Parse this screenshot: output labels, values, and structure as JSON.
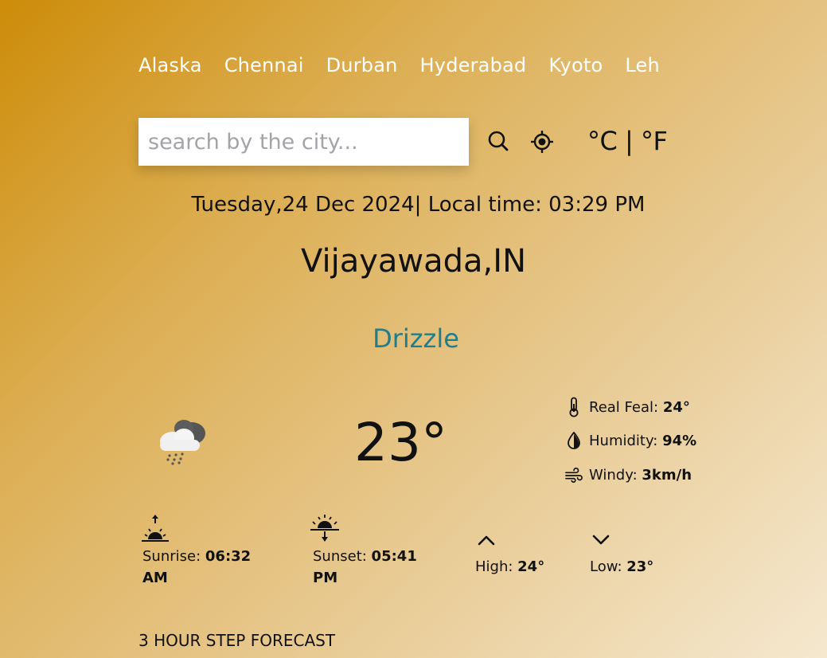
{
  "cities": [
    "Alaska",
    "Chennai",
    "Durban",
    "Hyderabad",
    "Kyoto",
    "Leh"
  ],
  "search": {
    "placeholder": "search by the city...",
    "value": ""
  },
  "icons": {
    "search": "search-icon",
    "location": "location-target-icon"
  },
  "units": {
    "label": "°C | °F"
  },
  "datetime": "Tuesday,24 Dec 2024| Local time: 03:29 PM",
  "location": "Vijayawada,IN",
  "condition": "Drizzle",
  "temperature": "23°",
  "details": {
    "realfeel": {
      "label": "Real Feal: ",
      "value": "24°"
    },
    "humidity": {
      "label": "Humidity: ",
      "value": "94%"
    },
    "wind": {
      "label": "Windy: ",
      "value": "3km/h"
    }
  },
  "sun": {
    "sunrise": {
      "label": "Sunrise: ",
      "value": "06:32",
      "suffix": "AM"
    },
    "sunset": {
      "label": "Sunset: ",
      "value": "05:41",
      "suffix": "PM"
    }
  },
  "range": {
    "high": {
      "label": "High: ",
      "value": "24°"
    },
    "low": {
      "label": "Low: ",
      "value": "23°"
    }
  },
  "forecast_title": "3 HOUR STEP FORECAST",
  "colors": {
    "condition": "#1f7d8c",
    "city_links": "#ffffff"
  }
}
